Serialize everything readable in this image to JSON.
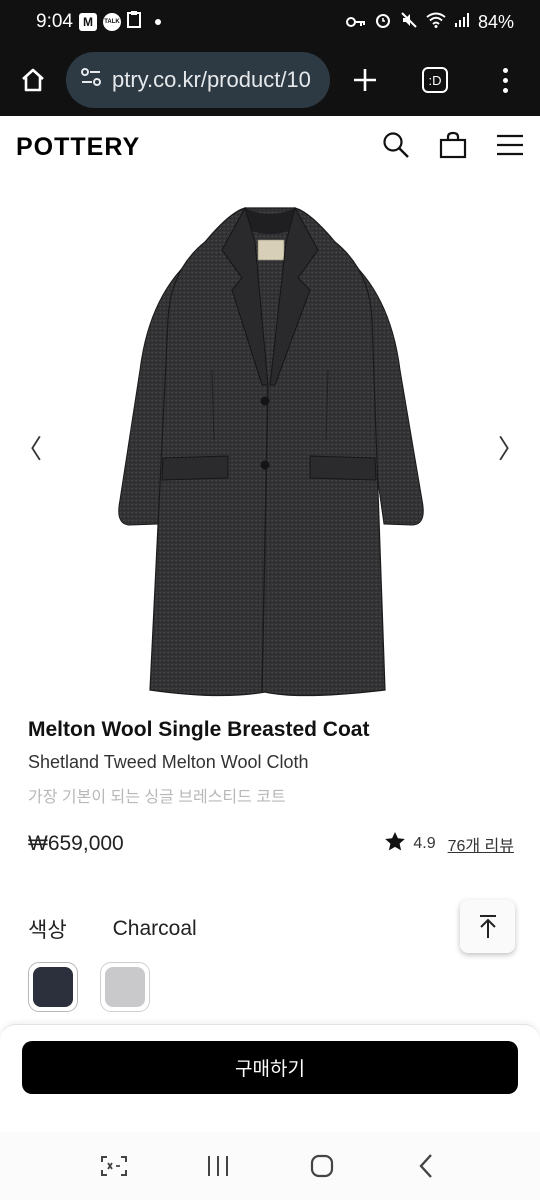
{
  "status_bar": {
    "time": "9:04",
    "notification_badges": [
      "M",
      "TALK"
    ],
    "battery": "84%"
  },
  "browser": {
    "url": "ptry.co.kr/product/10",
    "tabs_label": ":D"
  },
  "site": {
    "logo": "POTTERY"
  },
  "product": {
    "title": "Melton Wool Single Breasted Coat",
    "subtitle": "Shetland Tweed Melton Wool Cloth",
    "description": "가장 기본이 되는 싱글 브레스티드 코트",
    "price": "₩659,000",
    "rating": "4.9",
    "reviews_link": "76개 리뷰",
    "color_label": "색상",
    "selected_color": "Charcoal",
    "swatches": [
      {
        "color": "#2b303c"
      },
      {
        "color": "#c9c9cb"
      }
    ]
  },
  "carousel": {
    "prev": "〈",
    "next": "〉"
  },
  "actions": {
    "buy_label": "구매하기"
  },
  "colors": {
    "browser_bg": "#111111",
    "url_bg": "#2d3a43",
    "buy_button_bg": "#000000"
  }
}
